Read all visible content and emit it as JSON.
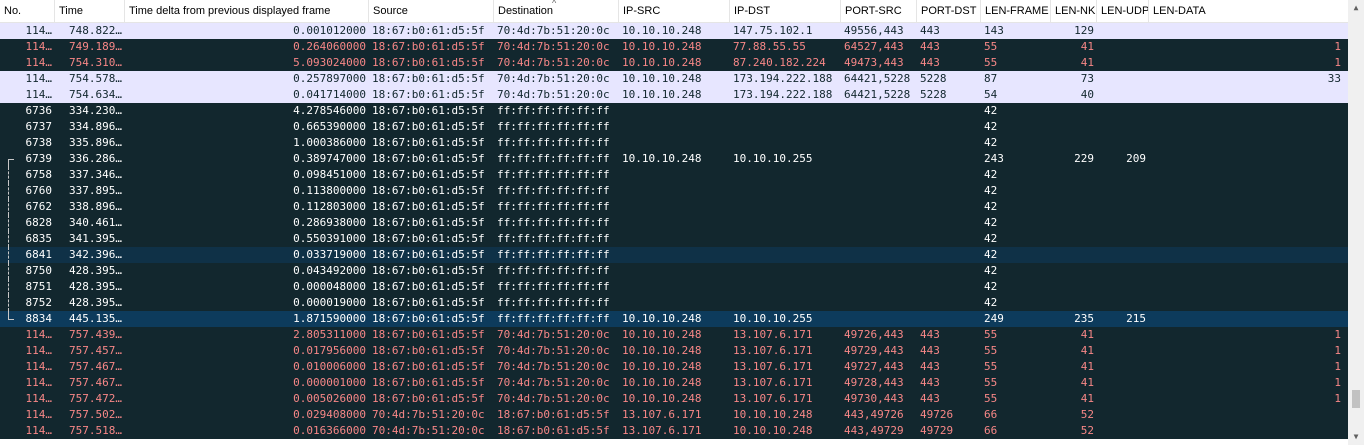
{
  "columns": [
    "No.",
    "Time",
    "Time delta from previous displayed frame",
    "Source",
    "Destination",
    "IP-SRC",
    "IP-DST",
    "PORT-SRC",
    "PORT-DST",
    "LEN-FRAME",
    "LEN-NK",
    "LEN-UDP",
    "LEN-DATA"
  ],
  "colors": {
    "purple_bg": "#e7e6ff",
    "purple_fg": "#12272e",
    "navy_bg": "#12272e",
    "navy_fg": "#f78787",
    "dark_bg": "#12272e",
    "dark_fg": "#ffffff",
    "selected_bg": "#0d3b5c",
    "focus_bg": "#0f3147"
  },
  "rows": [
    {
      "style": "purple",
      "tree": "",
      "cells": [
        "114…",
        "748.822…",
        "0.001012000",
        "18:67:b0:61:d5:5f",
        "70:4d:7b:51:20:0c",
        "10.10.10.248",
        "147.75.102.1",
        "49556,443",
        "443",
        "143",
        "129",
        "",
        ""
      ]
    },
    {
      "style": "navy",
      "tree": "",
      "cells": [
        "114…",
        "749.189…",
        "0.264060000",
        "18:67:b0:61:d5:5f",
        "70:4d:7b:51:20:0c",
        "10.10.10.248",
        "77.88.55.55",
        "64527,443",
        "443",
        "55",
        "41",
        "",
        "1"
      ]
    },
    {
      "style": "navy",
      "tree": "",
      "cells": [
        "114…",
        "754.310…",
        "5.093024000",
        "18:67:b0:61:d5:5f",
        "70:4d:7b:51:20:0c",
        "10.10.10.248",
        "87.240.182.224",
        "49473,443",
        "443",
        "55",
        "41",
        "",
        "1"
      ]
    },
    {
      "style": "purple",
      "tree": "",
      "cells": [
        "114…",
        "754.578…",
        "0.257897000",
        "18:67:b0:61:d5:5f",
        "70:4d:7b:51:20:0c",
        "10.10.10.248",
        "173.194.222.188",
        "64421,5228",
        "5228",
        "87",
        "73",
        "",
        "33"
      ]
    },
    {
      "style": "purple",
      "tree": "",
      "cells": [
        "114…",
        "754.634…",
        "0.041714000",
        "18:67:b0:61:d5:5f",
        "70:4d:7b:51:20:0c",
        "10.10.10.248",
        "173.194.222.188",
        "64421,5228",
        "5228",
        "54",
        "40",
        "",
        ""
      ]
    },
    {
      "style": "dark",
      "tree": "",
      "cells": [
        "6736",
        "334.230…",
        "4.278546000",
        "18:67:b0:61:d5:5f",
        "ff:ff:ff:ff:ff:ff",
        "",
        "",
        "",
        "",
        "42",
        "",
        "",
        ""
      ]
    },
    {
      "style": "dark",
      "tree": "",
      "cells": [
        "6737",
        "334.896…",
        "0.665390000",
        "18:67:b0:61:d5:5f",
        "ff:ff:ff:ff:ff:ff",
        "",
        "",
        "",
        "",
        "42",
        "",
        "",
        ""
      ]
    },
    {
      "style": "dark",
      "tree": "",
      "cells": [
        "6738",
        "335.896…",
        "1.000386000",
        "18:67:b0:61:d5:5f",
        "ff:ff:ff:ff:ff:ff",
        "",
        "",
        "",
        "",
        "42",
        "",
        "",
        ""
      ]
    },
    {
      "style": "dark",
      "tree": "first",
      "cells": [
        "6739",
        "336.286…",
        "0.389747000",
        "18:67:b0:61:d5:5f",
        "ff:ff:ff:ff:ff:ff",
        "10.10.10.248",
        "10.10.10.255",
        "",
        "",
        "243",
        "229",
        "209",
        ""
      ]
    },
    {
      "style": "dark",
      "tree": "mid",
      "cells": [
        "6758",
        "337.346…",
        "0.098451000",
        "18:67:b0:61:d5:5f",
        "ff:ff:ff:ff:ff:ff",
        "",
        "",
        "",
        "",
        "42",
        "",
        "",
        ""
      ]
    },
    {
      "style": "dark",
      "tree": "mid",
      "cells": [
        "6760",
        "337.895…",
        "0.113800000",
        "18:67:b0:61:d5:5f",
        "ff:ff:ff:ff:ff:ff",
        "",
        "",
        "",
        "",
        "42",
        "",
        "",
        ""
      ]
    },
    {
      "style": "dark",
      "tree": "mid",
      "cells": [
        "6762",
        "338.896…",
        "0.112803000",
        "18:67:b0:61:d5:5f",
        "ff:ff:ff:ff:ff:ff",
        "",
        "",
        "",
        "",
        "42",
        "",
        "",
        ""
      ]
    },
    {
      "style": "dark",
      "tree": "mid",
      "cells": [
        "6828",
        "340.461…",
        "0.286938000",
        "18:67:b0:61:d5:5f",
        "ff:ff:ff:ff:ff:ff",
        "",
        "",
        "",
        "",
        "42",
        "",
        "",
        ""
      ]
    },
    {
      "style": "dark",
      "tree": "mid",
      "cells": [
        "6835",
        "341.395…",
        "0.550391000",
        "18:67:b0:61:d5:5f",
        "ff:ff:ff:ff:ff:ff",
        "",
        "",
        "",
        "",
        "42",
        "",
        "",
        ""
      ]
    },
    {
      "style": "focus",
      "tree": "mid",
      "cells": [
        "6841",
        "342.396…",
        "0.033719000",
        "18:67:b0:61:d5:5f",
        "ff:ff:ff:ff:ff:ff",
        "",
        "",
        "",
        "",
        "42",
        "",
        "",
        ""
      ]
    },
    {
      "style": "dark",
      "tree": "mid",
      "cells": [
        "8750",
        "428.395…",
        "0.043492000",
        "18:67:b0:61:d5:5f",
        "ff:ff:ff:ff:ff:ff",
        "",
        "",
        "",
        "",
        "42",
        "",
        "",
        ""
      ]
    },
    {
      "style": "dark",
      "tree": "mid",
      "cells": [
        "8751",
        "428.395…",
        "0.000048000",
        "18:67:b0:61:d5:5f",
        "ff:ff:ff:ff:ff:ff",
        "",
        "",
        "",
        "",
        "42",
        "",
        "",
        ""
      ]
    },
    {
      "style": "dark",
      "tree": "mid",
      "cells": [
        "8752",
        "428.395…",
        "0.000019000",
        "18:67:b0:61:d5:5f",
        "ff:ff:ff:ff:ff:ff",
        "",
        "",
        "",
        "",
        "42",
        "",
        "",
        ""
      ]
    },
    {
      "style": "selected",
      "tree": "last",
      "cells": [
        "8834",
        "445.135…",
        "1.871590000",
        "18:67:b0:61:d5:5f",
        "ff:ff:ff:ff:ff:ff",
        "10.10.10.248",
        "10.10.10.255",
        "",
        "",
        "249",
        "235",
        "215",
        ""
      ]
    },
    {
      "style": "navy",
      "tree": "",
      "cells": [
        "114…",
        "757.439…",
        "2.805311000",
        "18:67:b0:61:d5:5f",
        "70:4d:7b:51:20:0c",
        "10.10.10.248",
        "13.107.6.171",
        "49726,443",
        "443",
        "55",
        "41",
        "",
        "1"
      ]
    },
    {
      "style": "navy",
      "tree": "",
      "cells": [
        "114…",
        "757.457…",
        "0.017956000",
        "18:67:b0:61:d5:5f",
        "70:4d:7b:51:20:0c",
        "10.10.10.248",
        "13.107.6.171",
        "49729,443",
        "443",
        "55",
        "41",
        "",
        "1"
      ]
    },
    {
      "style": "navy",
      "tree": "",
      "cells": [
        "114…",
        "757.467…",
        "0.010006000",
        "18:67:b0:61:d5:5f",
        "70:4d:7b:51:20:0c",
        "10.10.10.248",
        "13.107.6.171",
        "49727,443",
        "443",
        "55",
        "41",
        "",
        "1"
      ]
    },
    {
      "style": "navy",
      "tree": "",
      "cells": [
        "114…",
        "757.467…",
        "0.000001000",
        "18:67:b0:61:d5:5f",
        "70:4d:7b:51:20:0c",
        "10.10.10.248",
        "13.107.6.171",
        "49728,443",
        "443",
        "55",
        "41",
        "",
        "1"
      ]
    },
    {
      "style": "navy",
      "tree": "",
      "cells": [
        "114…",
        "757.472…",
        "0.005026000",
        "18:67:b0:61:d5:5f",
        "70:4d:7b:51:20:0c",
        "10.10.10.248",
        "13.107.6.171",
        "49730,443",
        "443",
        "55",
        "41",
        "",
        "1"
      ]
    },
    {
      "style": "navy",
      "tree": "",
      "cells": [
        "114…",
        "757.502…",
        "0.029408000",
        "70:4d:7b:51:20:0c",
        "18:67:b0:61:d5:5f",
        "13.107.6.171",
        "10.10.10.248",
        "443,49726",
        "49726",
        "66",
        "52",
        "",
        ""
      ]
    },
    {
      "style": "navy",
      "tree": "",
      "cells": [
        "114…",
        "757.518…",
        "0.016366000",
        "70:4d:7b:51:20:0c",
        "18:67:b0:61:d5:5f",
        "13.107.6.171",
        "10.10.10.248",
        "443,49729",
        "49729",
        "66",
        "52",
        "",
        ""
      ]
    }
  ]
}
